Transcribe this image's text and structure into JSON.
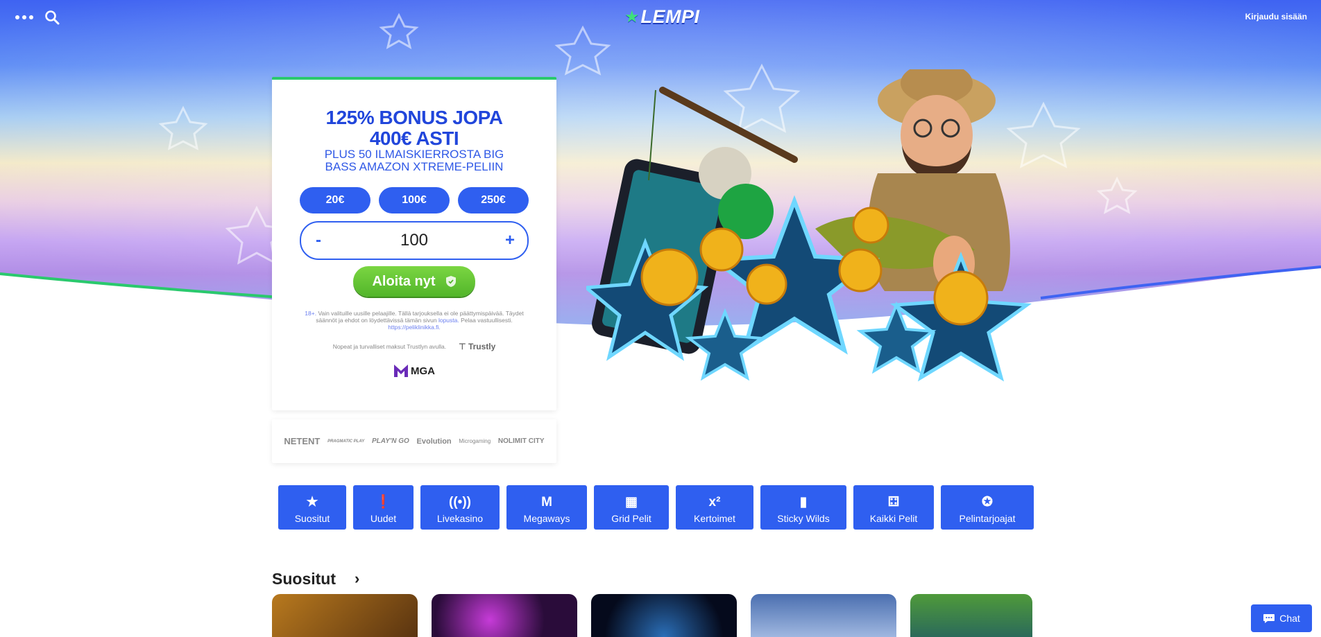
{
  "header": {
    "logo_text": "LEMPI",
    "login_label": "Kirjaudu sisään"
  },
  "bonus_card": {
    "title_line1": "125% BONUS JOPA",
    "title_line2": "400€ ASTI",
    "subtitle_line1": "PLUS 50 ILMAISKIERROSTA BIG",
    "subtitle_line2": "BASS AMAZON XTREME-PELIIN",
    "amount_options": [
      "20€",
      "100€",
      "250€"
    ],
    "stepper": {
      "minus": "-",
      "value": "100",
      "plus": "+"
    },
    "cta_label": "Aloita nyt",
    "disclaimer_age": "18+.",
    "disclaimer_text": " Vain valituille uusille pelaajille. Tällä tarjouksella ei ole päättymispäivää. Täydet säännöt ja ehdot on löydettävissä tämän sivun ",
    "disclaimer_link1": "lopusta.",
    "disclaimer_text2": " Pelaa vastuullisesti. ",
    "disclaimer_link2": "https://peliklinikka.fi.",
    "payment_text": "Nopeat ja turvalliset maksut Trustlyn avulla.",
    "trustly_label": "Trustly",
    "mga_label": "MGA"
  },
  "providers": [
    "NETENT",
    "PRAGMATIC PLAY",
    "PLAY'N GO",
    "Evolution",
    "Microgaming",
    "NOLIMIT CITY"
  ],
  "categories": [
    {
      "label": "Suositut",
      "icon": "star-icon"
    },
    {
      "label": "Uudet",
      "icon": "alert-icon"
    },
    {
      "label": "Livekasino",
      "icon": "broadcast-icon"
    },
    {
      "label": "Megaways",
      "icon": "megaways-icon"
    },
    {
      "label": "Grid Pelit",
      "icon": "grid-icon"
    },
    {
      "label": "Kertoimet",
      "icon": "multiplier-icon"
    },
    {
      "label": "Sticky Wilds",
      "icon": "card-icon"
    },
    {
      "label": "Kaikki Pelit",
      "icon": "dice-icon"
    },
    {
      "label": "Pelintarjoajat",
      "icon": "provider-icon"
    }
  ],
  "section": {
    "title": "Suositut"
  },
  "chat": {
    "label": "Chat"
  },
  "colors": {
    "primary": "#2f5ff0",
    "accent_green": "#52b52a",
    "title_blue": "#2146db"
  }
}
